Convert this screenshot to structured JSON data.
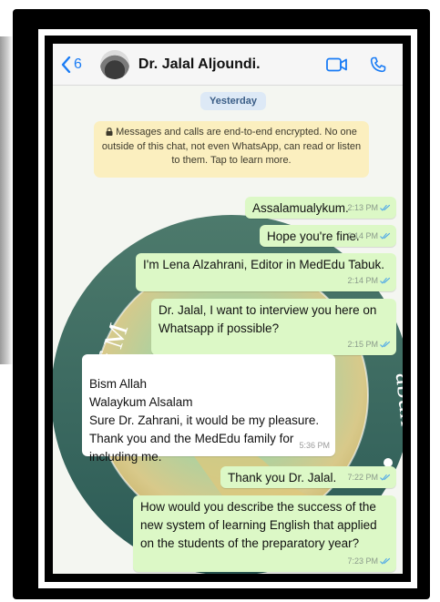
{
  "header": {
    "back_count": "6",
    "contact_name": "Dr. Jalal Aljoundi.",
    "icons": [
      "back-chevron-icon",
      "video-call-icon",
      "phone-call-icon"
    ]
  },
  "chat": {
    "date_pill": "Yesterday",
    "encryption_notice": "Messages and calls are end-to-end encrypted. No one outside of this chat, not even WhatsApp, can read or listen to them. Tap to learn more.",
    "background_text_left": "icine",
    "background_text_arc": "ty of M",
    "background_text_right": "abuk",
    "messages": [
      {
        "direction": "outgoing",
        "text": "Assalamualykum.",
        "time": "2:13 PM",
        "status": "read"
      },
      {
        "direction": "outgoing",
        "text": "Hope you're fine.",
        "time": "2:14 PM",
        "status": "read"
      },
      {
        "direction": "outgoing",
        "text": "I'm Lena Alzahrani, Editor in MedEdu Tabuk.",
        "time": "2:14 PM",
        "status": "read"
      },
      {
        "direction": "outgoing",
        "text": "Dr. Jalal, I want to interview you here on Whatsapp if possible?",
        "time": "2:15 PM",
        "status": "read"
      },
      {
        "direction": "incoming",
        "text": "Bism Allah\nWalaykum Alsalam\nSure Dr. Zahrani, it would be my pleasure.\nThank you and the MedEdu family for including me.",
        "time": "5:36 PM"
      },
      {
        "direction": "outgoing",
        "text": "Thank you Dr. Jalal.",
        "time": "7:22 PM",
        "status": "read"
      },
      {
        "direction": "outgoing",
        "text": "How would you describe the success of the new system of learning English that applied on the students of the preparatory year?",
        "time": "7:23 PM",
        "status": "read"
      }
    ]
  },
  "colors": {
    "outgoing_bubble": "#dcf8c6",
    "incoming_bubble": "#ffffff",
    "accent": "#1a7cf5",
    "notice_bg": "#fbefbf",
    "read_ticks": "#4fa8e8"
  }
}
